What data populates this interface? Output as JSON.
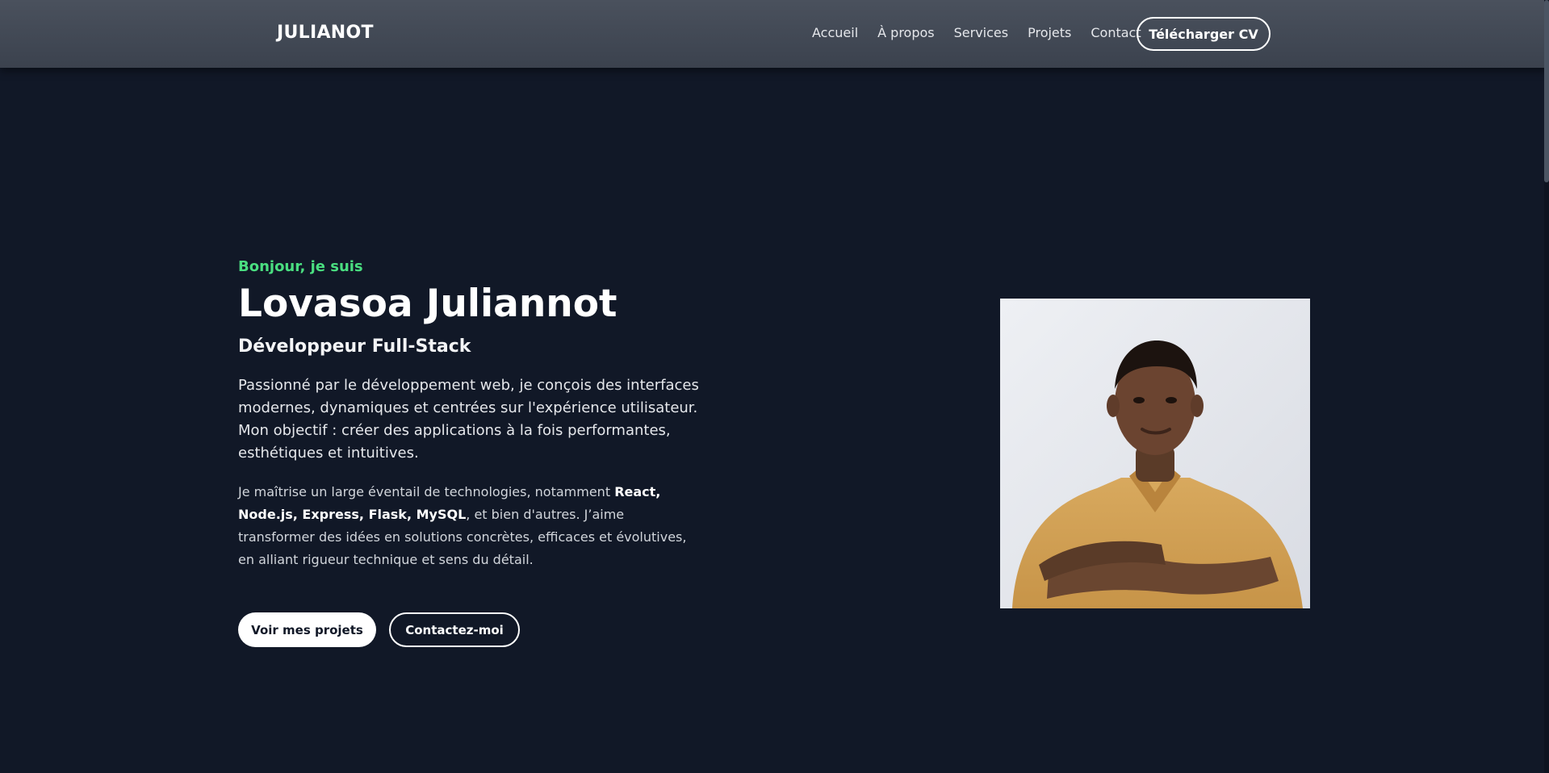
{
  "header": {
    "brand": "JULIANOT",
    "nav": [
      "Accueil",
      "À propos",
      "Services",
      "Projets",
      "Contact"
    ],
    "cv_button": "Télécharger CV"
  },
  "hero": {
    "greeting": "Bonjour, je suis",
    "name": "Lovasoa Juliannot",
    "role": "Développeur Full-Stack",
    "intro": "Passionné par le développement web, je conçois des interfaces modernes, dynamiques et centrées sur l'expérience utilisateur. Mon objectif : créer des applications à la fois performantes, esthétiques et intuitives.",
    "skills_prefix": "Je maîtrise un large éventail de technologies, notamment ",
    "skills_bold": "React, Node.js, Express, Flask, MySQL",
    "skills_suffix": ", et bien d'autres. J’aime transformer des idées en solutions concrètes, efficaces et évolutives, en alliant rigueur technique et sens du détail.",
    "primary_button": "Voir mes projets",
    "secondary_button": "Contactez-moi"
  },
  "colors": {
    "background": "#111827",
    "navbar": "#454c58",
    "accent_green": "#4ade80"
  },
  "icons": {
    "profile_photo": "portrait-photo"
  }
}
